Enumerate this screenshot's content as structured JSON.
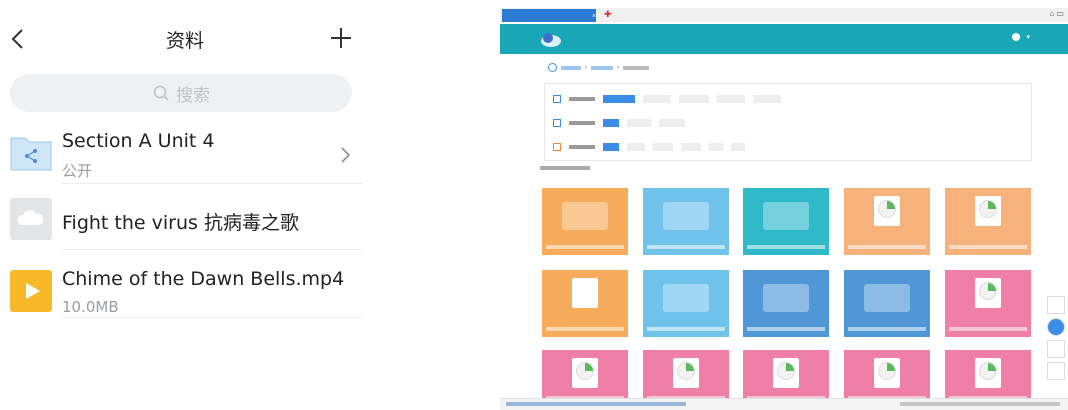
{
  "phone": {
    "title": "资料",
    "search_placeholder": "搜索",
    "files": [
      {
        "name": "Section A Unit 4",
        "meta": "公开",
        "icon": "shared-folder-icon",
        "has_chevron": true
      },
      {
        "name": "Fight the virus 抗病毒之歌",
        "meta": "",
        "icon": "cloud-file-icon",
        "has_chevron": false
      },
      {
        "name": "Chime of the Dawn Bells.mp4",
        "meta": "10.0MB",
        "icon": "video-file-icon",
        "has_chevron": false
      }
    ]
  },
  "browser": {
    "accent_color": "#1aa8b8",
    "link_color": "#3a8ee8",
    "nav_links": [
      "",
      "",
      "",
      "",
      "",
      "",
      ""
    ],
    "cards": [
      {
        "color": "#f6ac5a",
        "art": "teacher-board"
      },
      {
        "color": "#6fc3ea",
        "art": "teacher-board"
      },
      {
        "color": "#2fb9c9",
        "art": "monitor"
      },
      {
        "color": "#f6b27a",
        "art": "pie-doc"
      },
      {
        "color": "#f6b27a",
        "art": "pie-doc"
      },
      {
        "color": "#f6ac5a",
        "art": "doc"
      },
      {
        "color": "#6fc3ea",
        "art": "gears"
      },
      {
        "color": "#4f97d6",
        "art": "kids"
      },
      {
        "color": "#4f97d6",
        "art": "kids"
      },
      {
        "color": "#ef7fa6",
        "art": "pie-doc"
      },
      {
        "color": "#ef7fa6",
        "art": "pie-doc"
      },
      {
        "color": "#ef7fa6",
        "art": "pie-doc"
      },
      {
        "color": "#ef7fa6",
        "art": "pie-doc"
      },
      {
        "color": "#ef7fa6",
        "art": "pie-doc"
      },
      {
        "color": "#ef7fa6",
        "art": "pie-doc"
      }
    ]
  }
}
